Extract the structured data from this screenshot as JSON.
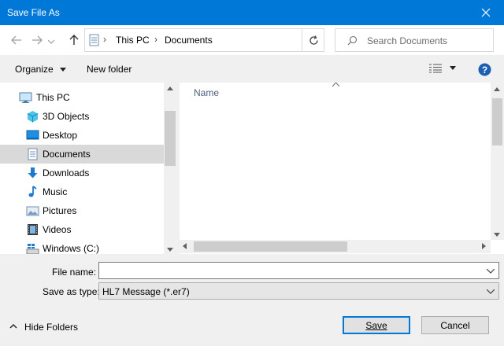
{
  "window": {
    "title": "Save File As"
  },
  "address": {
    "crumbs": [
      "This PC",
      "Documents"
    ]
  },
  "search": {
    "placeholder": "Search Documents"
  },
  "toolbar": {
    "organize_label": "Organize",
    "new_folder_label": "New folder"
  },
  "nav": {
    "items": [
      {
        "label": "This PC",
        "icon": "computer-icon",
        "selected": false
      },
      {
        "label": "3D Objects",
        "icon": "cube-icon",
        "selected": false
      },
      {
        "label": "Desktop",
        "icon": "desktop-icon",
        "selected": false
      },
      {
        "label": "Documents",
        "icon": "document-icon",
        "selected": true
      },
      {
        "label": "Downloads",
        "icon": "download-arrow-icon",
        "selected": false
      },
      {
        "label": "Music",
        "icon": "music-note-icon",
        "selected": false
      },
      {
        "label": "Pictures",
        "icon": "picture-icon",
        "selected": false
      },
      {
        "label": "Videos",
        "icon": "film-icon",
        "selected": false
      },
      {
        "label": "Windows (C:)",
        "icon": "drive-icon",
        "selected": false
      }
    ]
  },
  "files": {
    "column_name": "Name"
  },
  "form": {
    "file_name_label": "File name:",
    "file_name_value": "",
    "save_type_label": "Save as type:",
    "save_type_value": "HL7 Message (*.er7)"
  },
  "footer": {
    "hide_folders_label": "Hide Folders",
    "save_label": "Save",
    "cancel_label": "Cancel"
  },
  "colors": {
    "accent": "#0078d7",
    "selected_bg": "#d9d9d9"
  }
}
